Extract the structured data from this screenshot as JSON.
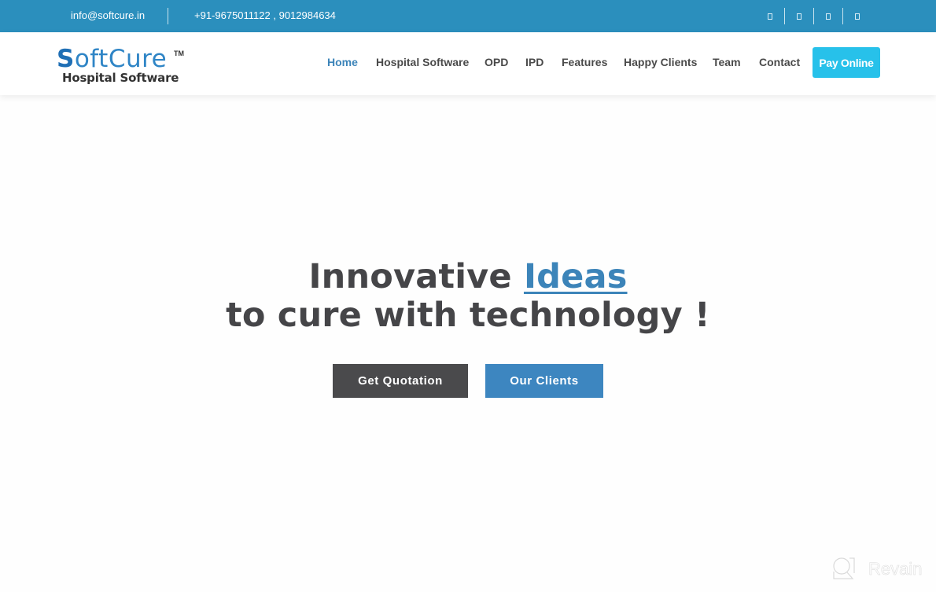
{
  "topbar": {
    "email": "info@softcure.in",
    "phone": "+91-9675011122 , 9012984634",
    "social_icons": [
      "social-icon-1",
      "social-icon-2",
      "social-icon-3",
      "social-icon-4"
    ]
  },
  "logo": {
    "brand_s": "S",
    "brand_rest": "oftCure",
    "trademark": "TM",
    "tagline": "Hospital Software"
  },
  "nav": {
    "items": [
      {
        "label": "Home",
        "active": true
      },
      {
        "label": "Hospital Software"
      },
      {
        "label": "OPD"
      },
      {
        "label": "IPD"
      },
      {
        "label": "Features"
      },
      {
        "label": "Happy Clients"
      },
      {
        "label": "Team"
      },
      {
        "label": "Contact"
      }
    ],
    "pay_online": "Pay Online"
  },
  "hero": {
    "line1_prefix": "Innovative ",
    "line1_highlight": "Ideas",
    "line2": "to cure with technology !",
    "quote_button": "Get Quotation",
    "clients_button": "Our Clients"
  },
  "watermark": {
    "text": "Revain"
  },
  "colors": {
    "topbar": "#2b8fbd",
    "accent": "#3c84b9",
    "pay_button": "#27c1ea",
    "dark_button": "#4a4a4c"
  }
}
